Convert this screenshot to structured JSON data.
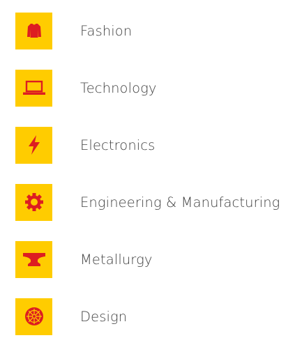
{
  "colors": {
    "tile_background": "#FFCC00",
    "icon": "#DD1D21",
    "label_text": "#404040"
  },
  "categories": [
    {
      "label": "Fashion",
      "icon": "sweater-icon"
    },
    {
      "label": "Technology",
      "icon": "laptop-icon"
    },
    {
      "label": "Electronics",
      "icon": "lightning-bolt-icon"
    },
    {
      "label": "Engineering & Manufacturing",
      "icon": "gear-icon"
    },
    {
      "label": "Metallurgy",
      "icon": "anvil-icon"
    },
    {
      "label": "Design",
      "icon": "color-wheel-icon"
    }
  ]
}
